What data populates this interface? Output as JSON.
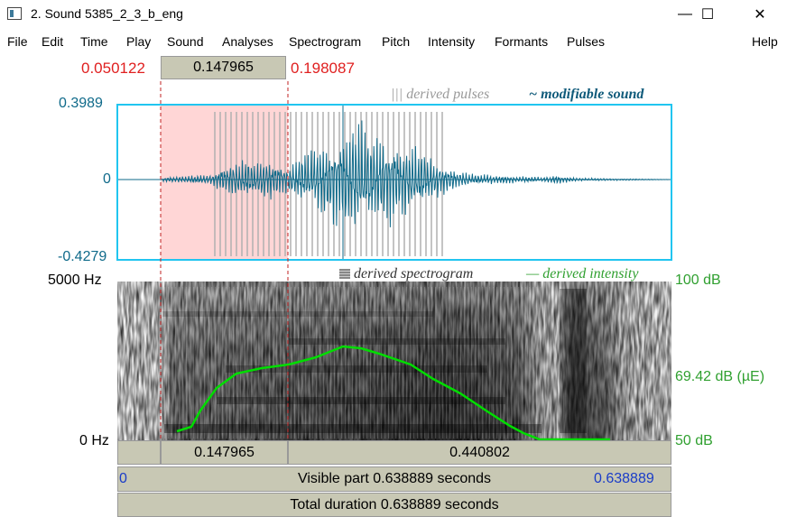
{
  "window": {
    "title": "2. Sound 5385_2_3_b_eng",
    "minimize_glyph": "—",
    "maximize_glyph": "☐",
    "close_glyph": "✕"
  },
  "menu": [
    "File",
    "Edit",
    "Time",
    "Play",
    "Sound",
    "Analyses",
    "Spectrogram",
    "Pitch",
    "Intensity",
    "Formants",
    "Pulses"
  ],
  "menu_help": "Help",
  "selection": {
    "start": "0.050122",
    "duration": "0.147965",
    "end": "0.198087"
  },
  "waveform": {
    "ymax_label": "0.3989",
    "yzero_label": "0",
    "ymin_label": "-0.4279",
    "pulses_legend": "derived pulses",
    "sound_legend": "modifiable sound",
    "pulses_glyph": "|||",
    "sound_glyph": "~"
  },
  "spectrogram": {
    "fmax_label": "5000 Hz",
    "fmin_label": "0 Hz",
    "spectrogram_legend": "derived spectrogram",
    "intensity_legend": "derived intensity",
    "intensity_glyph": "—",
    "db_max_label": "100 dB",
    "db_mid_label": "69.42 dB (µE)",
    "db_min_label": "50 dB"
  },
  "time_bars": {
    "selection_duration": "0.147965",
    "after_selection": "0.440802",
    "visible_start": "0",
    "visible_part": "Visible part 0.638889 seconds",
    "visible_end": "0.638889",
    "total_duration": "Total duration 0.638889 seconds"
  },
  "colors": {
    "selection_fill": "#ffd6d6",
    "waveform": "#0f6a8a",
    "pulses": "#b0b0b0",
    "frame": "#21c5f0",
    "intensity": "#00dd00",
    "cursor_line": "#c02020"
  }
}
